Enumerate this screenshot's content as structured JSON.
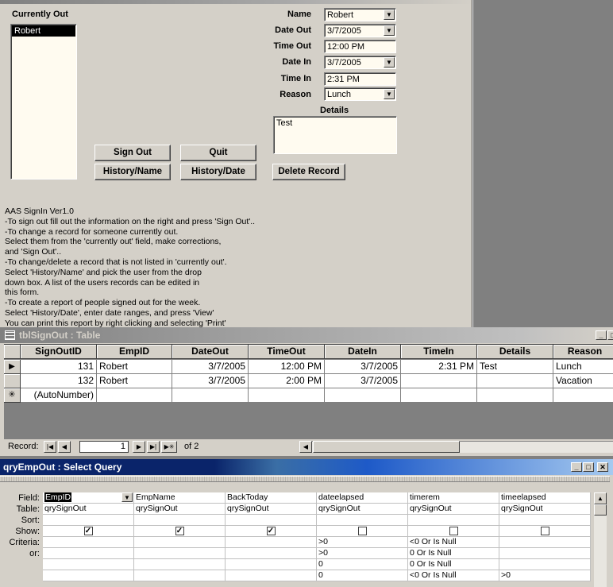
{
  "form": {
    "currently_out_label": "Currently Out",
    "currently_out_items": [
      "Robert"
    ],
    "fields": {
      "name": {
        "label": "Name",
        "value": "Robert"
      },
      "date_out": {
        "label": "Date Out",
        "value": "3/7/2005"
      },
      "time_out": {
        "label": "Time Out",
        "value": "12:00 PM"
      },
      "date_in": {
        "label": "Date In",
        "value": "3/7/2005"
      },
      "time_in": {
        "label": "Time In",
        "value": "2:31 PM"
      },
      "reason": {
        "label": "Reason",
        "value": "Lunch"
      },
      "details": {
        "label": "Details",
        "value": "Test"
      }
    },
    "buttons": {
      "sign_out": "Sign Out",
      "quit": "Quit",
      "history_name": "History/Name",
      "history_date": "History/Date",
      "delete_record": "Delete Record"
    },
    "info_lines": [
      "AAS SignIn Ver1.0",
      "-To sign out fill out the information on the right and press 'Sign Out'..",
      "-To change a record for someone currently out.",
      "Select them from the 'currently out' field, make corrections,",
      "and 'Sign Out'..",
      "-To change/delete a record that is not listed in 'currently out'.",
      "Select 'History/Name' and pick the user from the drop",
      "down box.  A list of the users records can be edited in",
      "this form.",
      "-To create a report of people signed out for the week.",
      "Select 'History/Date', enter date ranges, and press 'View'",
      "You can print this report by right clicking and selecting 'Print'"
    ]
  },
  "table_window": {
    "title": "tblSignOut : Table",
    "columns": [
      "SignOutID",
      "EmpID",
      "DateOut",
      "TimeOut",
      "DateIn",
      "TimeIn",
      "Details",
      "Reason"
    ],
    "rows": [
      {
        "marker": "▶",
        "cells": [
          "131",
          "Robert",
          "3/7/2005",
          "12:00 PM",
          "3/7/2005",
          "2:31 PM",
          "Test",
          "Lunch"
        ]
      },
      {
        "marker": "",
        "cells": [
          "132",
          "Robert",
          "3/7/2005",
          "2:00 PM",
          "3/7/2005",
          "",
          "",
          "Vacation"
        ]
      },
      {
        "marker": "✳",
        "cells": [
          "(AutoNumber)",
          "",
          "",
          "",
          "",
          "",
          "",
          ""
        ]
      }
    ],
    "nav": {
      "record_label": "Record:",
      "current": "1",
      "of_label": "of  2"
    }
  },
  "query_window": {
    "title": "qryEmpOut : Select Query",
    "row_labels": [
      "Field:",
      "Table:",
      "Sort:",
      "Show:",
      "Criteria:",
      "or:",
      "",
      ""
    ],
    "columns": [
      {
        "field": "EmpID",
        "table": "qrySignOut",
        "show": true,
        "criteria": [
          "",
          "",
          "",
          ""
        ]
      },
      {
        "field": "EmpName",
        "table": "qrySignOut",
        "show": true,
        "criteria": [
          "",
          "",
          "",
          ""
        ]
      },
      {
        "field": "BackToday",
        "table": "qrySignOut",
        "show": true,
        "criteria": [
          "",
          "",
          "",
          ""
        ]
      },
      {
        "field": "dateelapsed",
        "table": "qrySignOut",
        "show": false,
        "criteria": [
          ">0",
          ">0",
          "0",
          "0"
        ]
      },
      {
        "field": "timerem",
        "table": "qrySignOut",
        "show": false,
        "criteria": [
          "<0 Or Is Null",
          "0 Or Is Null",
          "0 Or Is Null",
          "<0 Or Is Null"
        ]
      },
      {
        "field": "timeelapsed",
        "table": "qrySignOut",
        "show": false,
        "criteria": [
          "",
          "",
          "",
          ">0"
        ]
      }
    ]
  },
  "icons": [
    "dropdown-arrow-icon",
    "table-icon",
    "minimize-icon",
    "restore-icon",
    "close-icon",
    "first-record-icon",
    "prev-record-icon",
    "next-record-icon",
    "last-record-icon",
    "new-record-icon"
  ],
  "colors": {
    "query_title_active": "#0a246a",
    "field_background": "#fffbf0",
    "dialog_gray": "#d4d0c8"
  }
}
